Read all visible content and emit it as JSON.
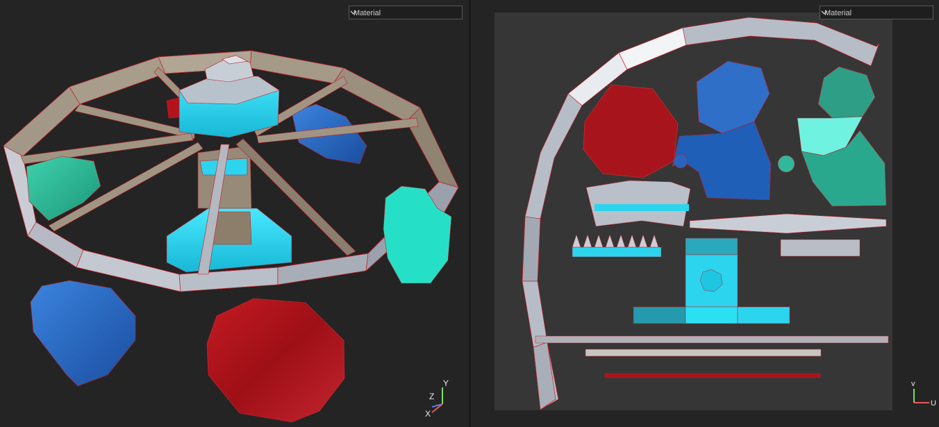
{
  "left_viewport": {
    "material_select": {
      "value": "Material"
    },
    "gizmo": {
      "y_label": "Y",
      "z_label": "Z",
      "x_label": "X"
    }
  },
  "right_viewport": {
    "material_select": {
      "value": "Material"
    },
    "gizmo": {
      "v_label": "v",
      "u_label": "U"
    }
  },
  "colors": {
    "background": "#242424",
    "uv_canvas": "#363636",
    "wood": "#9d9180",
    "cyan": "#2cd4ee",
    "teal": "#2fb89b",
    "blue": "#2f6fc8",
    "red": "#b3141b",
    "silver": "#b9c0c9",
    "edge": "#c11a24"
  }
}
